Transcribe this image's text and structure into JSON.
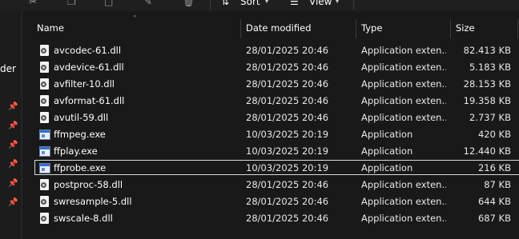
{
  "toolbar": {
    "sort_label": "Sort",
    "view_label": "View",
    "more_label": "···"
  },
  "nav": {
    "partial_label": "der"
  },
  "columns": {
    "name": "Name",
    "date": "Date modified",
    "type": "Type",
    "size": "Size"
  },
  "files": [
    {
      "name": "avcodec-61.dll",
      "date": "28/01/2025 20:46",
      "type": "Application exten...",
      "size": "82.413 KB",
      "icon": "dll"
    },
    {
      "name": "avdevice-61.dll",
      "date": "28/01/2025 20:46",
      "type": "Application exten...",
      "size": "5.183 KB",
      "icon": "dll"
    },
    {
      "name": "avfilter-10.dll",
      "date": "28/01/2025 20:46",
      "type": "Application exten...",
      "size": "28.153 KB",
      "icon": "dll"
    },
    {
      "name": "avformat-61.dll",
      "date": "28/01/2025 20:46",
      "type": "Application exten...",
      "size": "19.358 KB",
      "icon": "dll"
    },
    {
      "name": "avutil-59.dll",
      "date": "28/01/2025 20:46",
      "type": "Application exten...",
      "size": "2.737 KB",
      "icon": "dll"
    },
    {
      "name": "ffmpeg.exe",
      "date": "10/03/2025 20:19",
      "type": "Application",
      "size": "420 KB",
      "icon": "exe"
    },
    {
      "name": "ffplay.exe",
      "date": "10/03/2025 20:19",
      "type": "Application",
      "size": "12.440 KB",
      "icon": "exe"
    },
    {
      "name": "ffprobe.exe",
      "date": "10/03/2025 20:19",
      "type": "Application",
      "size": "216 KB",
      "icon": "exe",
      "selected": true
    },
    {
      "name": "postproc-58.dll",
      "date": "28/01/2025 20:46",
      "type": "Application exten...",
      "size": "87 KB",
      "icon": "dll"
    },
    {
      "name": "swresample-5.dll",
      "date": "28/01/2025 20:46",
      "type": "Application exten...",
      "size": "644 KB",
      "icon": "dll"
    },
    {
      "name": "swscale-8.dll",
      "date": "28/01/2025 20:46",
      "type": "Application exten...",
      "size": "687 KB",
      "icon": "dll"
    }
  ]
}
